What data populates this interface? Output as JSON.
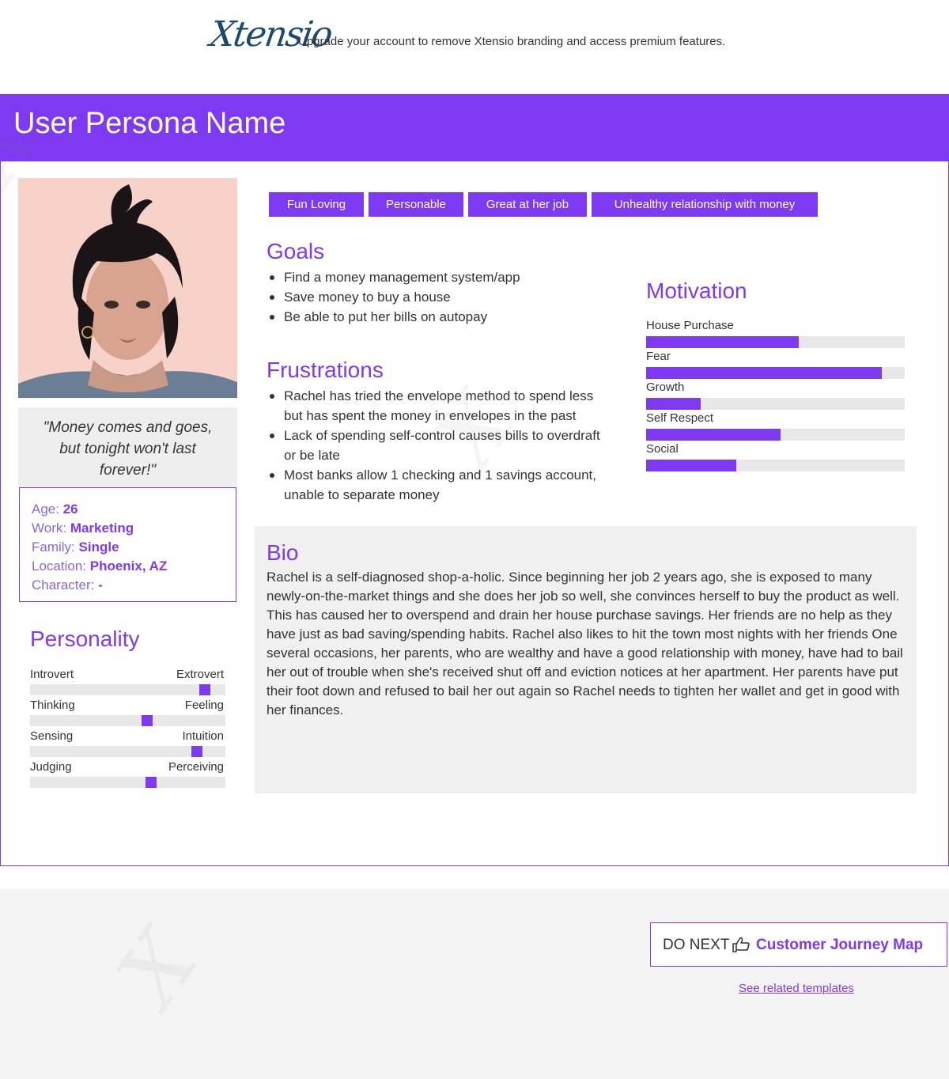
{
  "topbar": {
    "logo_text": "Xtensio",
    "promo_text": "Upgrade your account to remove Xtensio branding and access premium features."
  },
  "persona": {
    "name": "User Persona Name",
    "quote": "\"Money comes and goes, but tonight won't last forever!\"",
    "info": [
      {
        "label": "Age:",
        "value": "26"
      },
      {
        "label": "Work:",
        "value": "Marketing"
      },
      {
        "label": "Family:",
        "value": "Single"
      },
      {
        "label": "Location:",
        "value": "Phoenix, AZ"
      },
      {
        "label": "Character:",
        "value": "-"
      }
    ],
    "tags": [
      "Fun Loving",
      "Personable",
      "Great at her job",
      "Unhealthy relationship with money"
    ]
  },
  "personality": {
    "title": "Personality",
    "scales": [
      {
        "left": "Introvert",
        "right": "Extrovert",
        "value": 0.895
      },
      {
        "left": "Thinking",
        "right": "Feeling",
        "value": 0.6
      },
      {
        "left": "Sensing",
        "right": "Intuition",
        "value": 0.855
      },
      {
        "left": "Judging",
        "right": "Perceiving",
        "value": 0.62
      }
    ]
  },
  "goals": {
    "title": "Goals",
    "items": [
      "Find a money management system/app",
      "Save money to buy a house",
      "Be able to put her bills on autopay"
    ]
  },
  "frustrations": {
    "title": "Frustrations",
    "items": [
      "Rachel has tried the envelope method to spend less but has spent the money in envelopes in the past",
      "Lack of spending self-control causes bills to overdraft or be late",
      "Most banks allow 1 checking and 1 savings account, unable to separate money"
    ]
  },
  "motivation": {
    "title": "Motivation",
    "items": [
      {
        "label": "House Purchase",
        "value": 0.59
      },
      {
        "label": "Fear",
        "value": 0.91
      },
      {
        "label": "Growth",
        "value": 0.21
      },
      {
        "label": "Self Respect",
        "value": 0.52
      },
      {
        "label": "Social",
        "value": 0.35
      }
    ]
  },
  "bio": {
    "title": "Bio",
    "text": "Rachel is a self-diagnosed shop-a-holic. Since beginning her job 2 years ago, she is exposed to many newly-on-the-market things and she does her job so well, she convinces herself to buy the product as well. This has caused her to overspend and drain her house purchase savings. Her friends are no help as they have just as bad saving/spending habits. Rachel also likes to hit the town most nights with her friends One several occasions, her parents, who are wealthy and have a good relationship with money, have had to bail her out of trouble when she's received shut off and eviction notices at her apartment. Her parents have put their foot down and refused to bail her out again so Rachel needs to tighten her wallet and get in good with her finances."
  },
  "footer": {
    "do_next_label": "DO NEXT",
    "do_next_link": "Customer Journey Map",
    "related_link": "See related templates",
    "icon": "thumbs-up-icon"
  },
  "colors": {
    "accent": "#7e3af2",
    "track": "#e8e8e8",
    "panel": "#f0f0f0"
  }
}
